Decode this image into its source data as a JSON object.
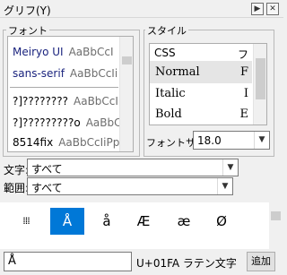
{
  "title": {
    "text": "グリフ(Y)",
    "buttons": [
      "▶",
      "✕"
    ]
  },
  "font_group": {
    "label": "フォント",
    "items": [
      {
        "name": "Meiryo UI",
        "sample": "AaBbCcI",
        "color": "#1a237e"
      },
      {
        "name": "sans-serif",
        "sample": "AaBbCcIi",
        "color": "#1a237e"
      },
      {
        "name": "?]????????",
        "sample": "AaBbCcI",
        "color": "#000000"
      },
      {
        "name": "?]?????????o",
        "sample": "AaBbC",
        "color": "#000000"
      },
      {
        "name": "8514fix",
        "sample": "AaBbCcIiPp",
        "color": "#000000"
      }
    ]
  },
  "style_group": {
    "label": "スタイル",
    "header": {
      "col1": "CSS",
      "col2": "フ"
    },
    "items": [
      {
        "name": "Normal",
        "col2": "F"
      },
      {
        "name": "Italic",
        "col2": "I"
      },
      {
        "name": "Bold",
        "col2": "E"
      }
    ],
    "font_size_label": "フォントサ",
    "font_size_value": "18.0"
  },
  "text_filter": {
    "label": "文字:",
    "value": "すべて"
  },
  "range_filter": {
    "label": "範囲:",
    "value": "すべて"
  },
  "glyphs": [
    "⁞⁞⁞",
    "Å",
    "å",
    "Æ",
    "æ",
    "Ø"
  ],
  "selected_glyph_index": 1,
  "bottom": {
    "preview_char": "Å",
    "codepoint": "U+01FA ラテン文字",
    "add_button": "追加"
  }
}
